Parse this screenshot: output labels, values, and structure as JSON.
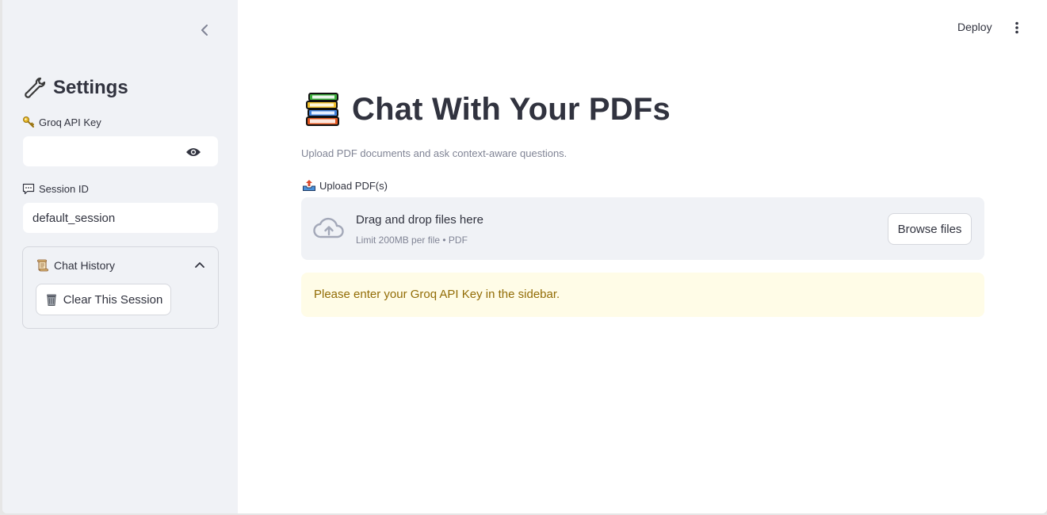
{
  "sidebar": {
    "title": "Settings",
    "api_key": {
      "label": "Groq API Key",
      "value": "",
      "placeholder": ""
    },
    "session": {
      "label": "Session ID",
      "value": "default_session"
    },
    "history": {
      "label": "Chat History",
      "clear_label": "Clear This Session"
    }
  },
  "header": {
    "deploy_label": "Deploy"
  },
  "main": {
    "title": "Chat With Your PDFs",
    "subtitle": "Upload PDF documents and ask context-aware questions.",
    "uploader": {
      "label": "Upload PDF(s)",
      "drop_text": "Drag and drop files here",
      "limit_text": "Limit 200MB per file • PDF",
      "browse_label": "Browse files"
    },
    "warning": "Please enter your Groq API Key in the sidebar."
  },
  "colors": {
    "sidebar_bg": "#f0f2f6",
    "warning_bg": "#fffce7",
    "warning_text": "#926c05",
    "text": "#31333f"
  },
  "icons": [
    "chevron-left-icon",
    "wrench-icon",
    "key-icon",
    "eye-icon",
    "speech-bubble-icon",
    "scroll-icon",
    "chevron-up-icon",
    "wastebasket-icon",
    "menu-kebab-icon",
    "books-icon",
    "outbox-tray-icon",
    "cloud-upload-icon"
  ]
}
